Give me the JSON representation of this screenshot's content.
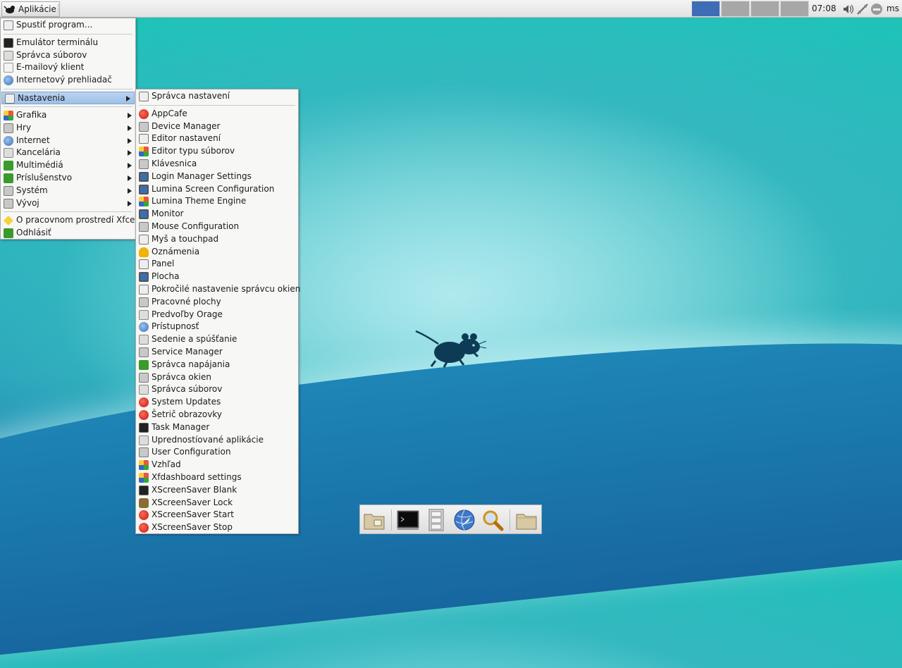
{
  "panel": {
    "apps_label": "Aplikácie",
    "clock": "07:08",
    "user": "ms",
    "workspaces": [
      {
        "active": true
      },
      {
        "active": false
      },
      {
        "active": false
      },
      {
        "active": false
      }
    ],
    "tray_icons": [
      "volume-icon",
      "network-icon",
      "power-icon"
    ]
  },
  "menu": {
    "groups": [
      [
        {
          "label": "Spustiť program...",
          "icon": "run-icon"
        }
      ],
      [
        {
          "label": "Emulátor terminálu",
          "icon": "terminal-icon"
        },
        {
          "label": "Správca súborov",
          "icon": "file-manager-icon"
        },
        {
          "label": "E-mailový klient",
          "icon": "mail-icon"
        },
        {
          "label": "Internetový prehliadač",
          "icon": "browser-icon"
        }
      ],
      [
        {
          "label": "Nastavenia",
          "icon": "settings-icon",
          "submenu": true,
          "selected": true
        }
      ],
      [
        {
          "label": "Grafika",
          "icon": "graphics-icon",
          "submenu": true
        },
        {
          "label": "Hry",
          "icon": "games-icon",
          "submenu": true
        },
        {
          "label": "Internet",
          "icon": "internet-icon",
          "submenu": true
        },
        {
          "label": "Kancelária",
          "icon": "office-icon",
          "submenu": true
        },
        {
          "label": "Multimédiá",
          "icon": "multimedia-icon",
          "submenu": true
        },
        {
          "label": "Príslušenstvo",
          "icon": "accessories-icon",
          "submenu": true
        },
        {
          "label": "Systém",
          "icon": "system-icon",
          "submenu": true
        },
        {
          "label": "Vývoj",
          "icon": "development-icon",
          "submenu": true
        }
      ],
      [
        {
          "label": "O pracovnom prostredí Xfce",
          "icon": "about-icon"
        },
        {
          "label": "Odhlásiť",
          "icon": "logout-icon"
        }
      ]
    ]
  },
  "submenu": {
    "groups": [
      [
        {
          "label": "Správca nastavení",
          "icon": "settings-manager-icon"
        }
      ],
      [
        {
          "label": "AppCafe",
          "icon": "appcafe-icon"
        },
        {
          "label": "Device Manager",
          "icon": "device-manager-icon"
        },
        {
          "label": "Editor nastavení",
          "icon": "settings-editor-icon"
        },
        {
          "label": "Editor typu súborov",
          "icon": "filetype-editor-icon"
        },
        {
          "label": "Klávesnica",
          "icon": "keyboard-icon"
        },
        {
          "label": "Login Manager Settings",
          "icon": "login-manager-icon"
        },
        {
          "label": "Lumina Screen Configuration",
          "icon": "screen-config-icon"
        },
        {
          "label": "Lumina Theme Engine",
          "icon": "theme-engine-icon"
        },
        {
          "label": "Monitor",
          "icon": "monitor-icon"
        },
        {
          "label": "Mouse Configuration",
          "icon": "mouse-config-icon"
        },
        {
          "label": "Myš a touchpad",
          "icon": "mouse-touchpad-icon"
        },
        {
          "label": "Oznámenia",
          "icon": "notifications-icon"
        },
        {
          "label": "Panel",
          "icon": "panel-icon"
        },
        {
          "label": "Plocha",
          "icon": "desktop-icon"
        },
        {
          "label": "Pokročilé nastavenie správcu okien",
          "icon": "wm-tweaks-icon"
        },
        {
          "label": "Pracovné plochy",
          "icon": "workspaces-icon"
        },
        {
          "label": "Predvoľby Orage",
          "icon": "orage-icon"
        },
        {
          "label": "Prístupnosť",
          "icon": "accessibility-icon"
        },
        {
          "label": "Sedenie a spúšťanie",
          "icon": "session-icon"
        },
        {
          "label": "Service Manager",
          "icon": "service-manager-icon"
        },
        {
          "label": "Správca napájania",
          "icon": "power-manager-icon"
        },
        {
          "label": "Správca okien",
          "icon": "window-manager-icon"
        },
        {
          "label": "Správca súborov",
          "icon": "file-manager-settings-icon"
        },
        {
          "label": "System Updates",
          "icon": "system-updates-icon"
        },
        {
          "label": "Šetrič obrazovky",
          "icon": "screensaver-icon"
        },
        {
          "label": "Task Manager",
          "icon": "task-manager-icon"
        },
        {
          "label": "Upredností­ované aplikácie",
          "icon": "preferred-apps-icon"
        },
        {
          "label": "User Configuration",
          "icon": "user-config-icon"
        },
        {
          "label": "Vzhľad",
          "icon": "appearance-icon"
        },
        {
          "label": "Xfdashboard settings",
          "icon": "xfdashboard-icon"
        },
        {
          "label": "XScreenSaver Blank",
          "icon": "xscreensaver-blank-icon"
        },
        {
          "label": "XScreenSaver Lock",
          "icon": "xscreensaver-lock-icon"
        },
        {
          "label": "XScreenSaver Start",
          "icon": "xscreensaver-start-icon"
        },
        {
          "label": "XScreenSaver Stop",
          "icon": "xscreensaver-stop-icon"
        }
      ]
    ]
  },
  "dock": {
    "items": [
      {
        "icon": "home-folder-icon"
      },
      {
        "icon": "terminal-icon"
      },
      {
        "icon": "file-cabinet-icon"
      },
      {
        "icon": "web-browser-icon"
      },
      {
        "icon": "app-finder-icon"
      },
      {
        "icon": "folder-icon"
      }
    ]
  }
}
